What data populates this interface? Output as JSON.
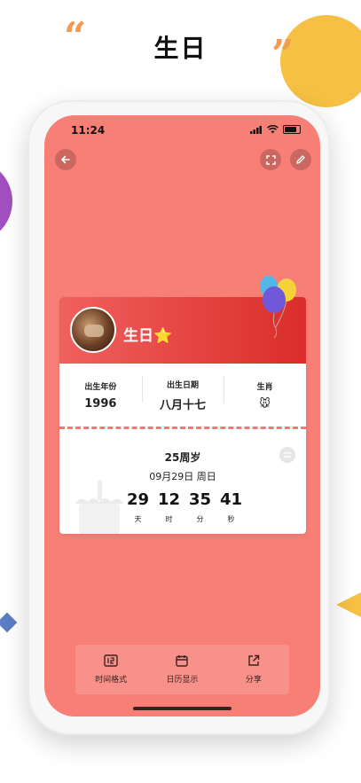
{
  "promo": {
    "heading": "生日",
    "quote_open": "“",
    "quote_close": "”"
  },
  "status_bar": {
    "time": "11:24"
  },
  "top_actions": {
    "back_icon": "arrow-left-icon",
    "fullscreen_icon": "fullscreen-icon",
    "edit_icon": "pencil-icon"
  },
  "card": {
    "title": "生日",
    "title_emoji": "⭐",
    "info": [
      {
        "label": "出生年份",
        "value": "1996"
      },
      {
        "label": "出生日期",
        "value": "八月十七"
      },
      {
        "label": "生肖",
        "value": "🐭"
      }
    ],
    "countdown": {
      "title": "25周岁",
      "date": "09月29日 周日",
      "values": [
        {
          "num": "29",
          "unit": "天"
        },
        {
          "num": "12",
          "unit": "时"
        },
        {
          "num": "35",
          "unit": "分"
        },
        {
          "num": "41",
          "unit": "秒"
        }
      ]
    }
  },
  "toolbar": {
    "items": [
      {
        "label": "时间格式",
        "icon": "time-format-icon"
      },
      {
        "label": "日历显示",
        "icon": "calendar-icon"
      },
      {
        "label": "分享",
        "icon": "share-icon"
      }
    ]
  },
  "colors": {
    "screen_bg": "#f77f76",
    "header_start": "#f0615e",
    "header_end": "#da2d2a",
    "accent_yellow": "#f5c043",
    "accent_purple": "#a14fc1"
  }
}
